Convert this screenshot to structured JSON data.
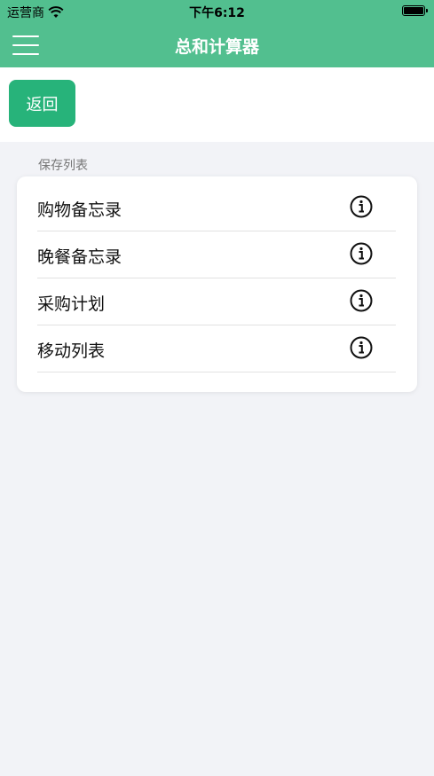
{
  "status": {
    "carrier": "运营商",
    "time": "下午6:12",
    "wifi_icon": "wifi-icon",
    "battery_icon": "battery-icon"
  },
  "nav": {
    "title": "总和计算器",
    "menu_icon": "hamburger-menu-icon"
  },
  "back_label": "返回",
  "section": {
    "header": "保存列表"
  },
  "list": [
    {
      "label": "购物备忘录"
    },
    {
      "label": "晚餐备忘录"
    },
    {
      "label": "采购计划"
    },
    {
      "label": "移动列表"
    }
  ],
  "colors": {
    "nav_bg": "#52bf8f",
    "button_bg": "#27b37a",
    "page_bg": "#f2f3f7"
  }
}
